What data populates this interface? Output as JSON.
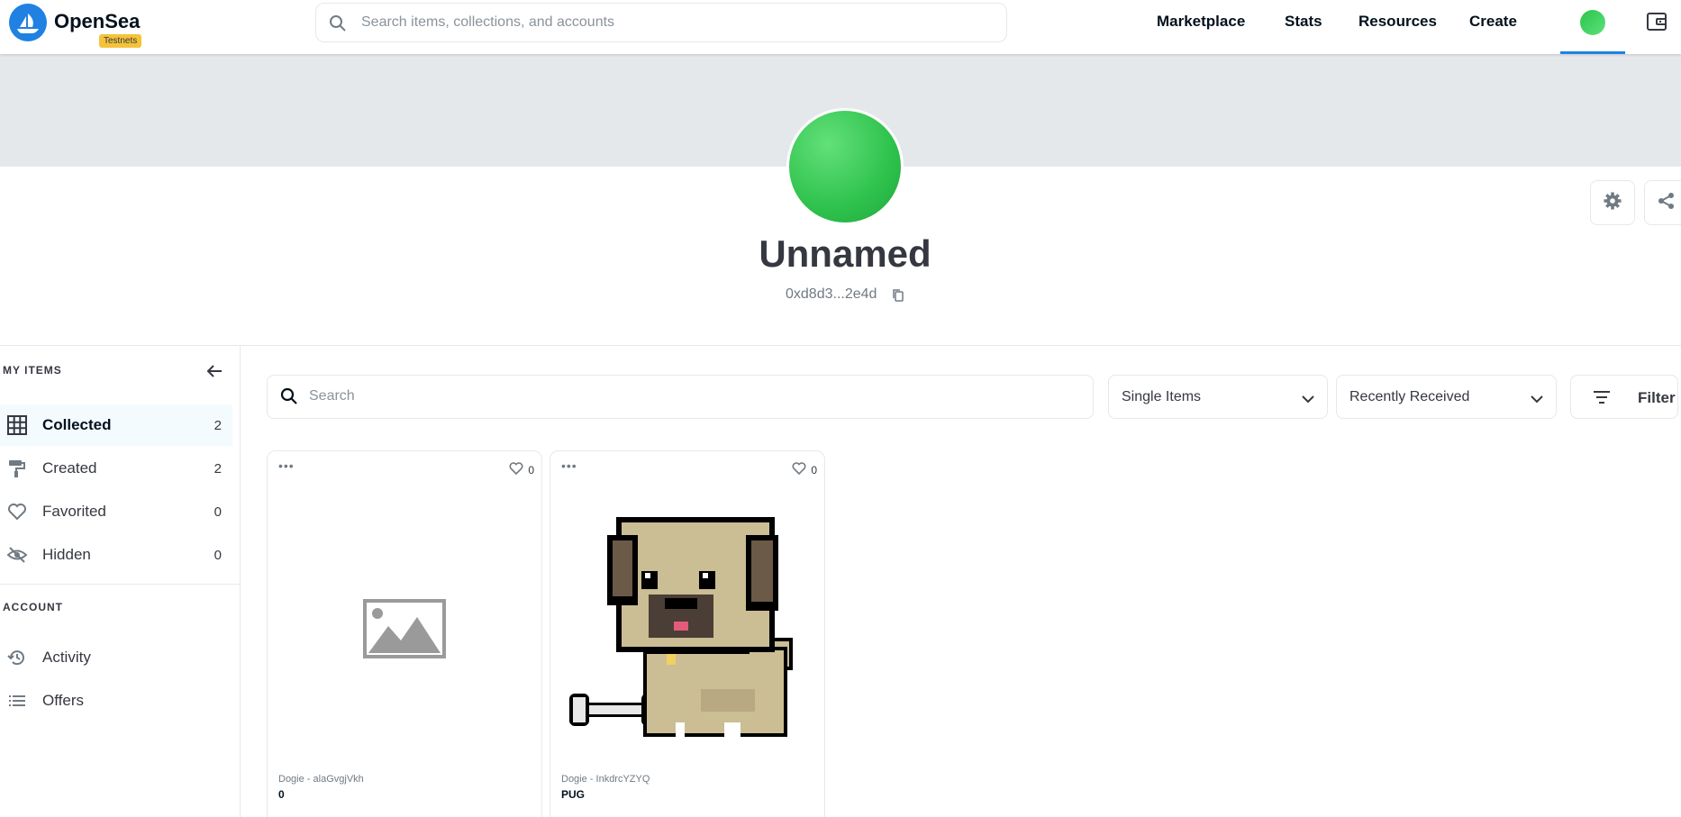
{
  "header": {
    "brand": "OpenSea",
    "badge": "Testnets",
    "search_placeholder": "Search items, collections, and accounts",
    "nav": [
      "Marketplace",
      "Stats",
      "Resources",
      "Create"
    ]
  },
  "profile": {
    "name": "Unnamed",
    "address": "0xd8d3...2e4d"
  },
  "sidebar": {
    "my_items_title": "MY ITEMS",
    "items": [
      {
        "label": "Collected",
        "count": "2",
        "icon": "grid-icon"
      },
      {
        "label": "Created",
        "count": "2",
        "icon": "paint-roller-icon"
      },
      {
        "label": "Favorited",
        "count": "0",
        "icon": "heart-icon"
      },
      {
        "label": "Hidden",
        "count": "0",
        "icon": "eye-slash-icon"
      }
    ],
    "account_title": "ACCOUNT",
    "account_items": [
      {
        "label": "Activity",
        "icon": "history-icon"
      },
      {
        "label": "Offers",
        "icon": "list-icon"
      }
    ]
  },
  "toolbar": {
    "search_placeholder": "Search",
    "type_select": "Single Items",
    "sort_select": "Recently Received",
    "filter_label": "Filter"
  },
  "cards": [
    {
      "collection": "Dogie - alaGvgjVkh",
      "name": "0",
      "likes": "0",
      "media": "image-placeholder-icon"
    },
    {
      "collection": "Dogie - InkdrcYZYQ",
      "name": "PUG",
      "likes": "0",
      "media": "pug-image"
    }
  ],
  "colors": {
    "accent": "#2081e2",
    "badge": "#f5c33a",
    "avatar": "#2ec24c",
    "banner": "#e5e8eb"
  }
}
